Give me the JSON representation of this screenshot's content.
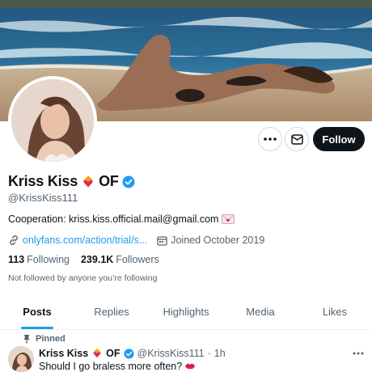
{
  "profile": {
    "name": "Kriss Kiss",
    "name_suffix": "OF",
    "handle": "@KrissKiss111",
    "bio": "Cooperation: kriss.kiss.official.mail@gmail.com",
    "link": "onlyfans.com/action/trial/s...",
    "joined": "Joined October 2019",
    "following_count": "113",
    "following_label": "Following",
    "followers_count": "239.1K",
    "followers_label": "Followers",
    "not_followed": "Not followed by anyone you’re following"
  },
  "actions": {
    "more_icon": "more-horizontal-icon",
    "mail_icon": "envelope-icon",
    "follow_label": "Follow"
  },
  "tabs": [
    {
      "label": "Posts",
      "active": true
    },
    {
      "label": "Replies",
      "active": false
    },
    {
      "label": "Highlights",
      "active": false
    },
    {
      "label": "Media",
      "active": false
    },
    {
      "label": "Likes",
      "active": false
    }
  ],
  "tweet": {
    "pinned_label": "Pinned",
    "author_name": "Kriss Kiss",
    "author_suffix": "OF",
    "author_handle": "@KrissKiss111",
    "separator": "·",
    "time": "1h",
    "text": "Should I go braless more often?"
  },
  "colors": {
    "accent": "#1d9bf0",
    "text_primary": "#0f1419",
    "text_secondary": "#536471",
    "follow_bg": "#0f1419"
  }
}
